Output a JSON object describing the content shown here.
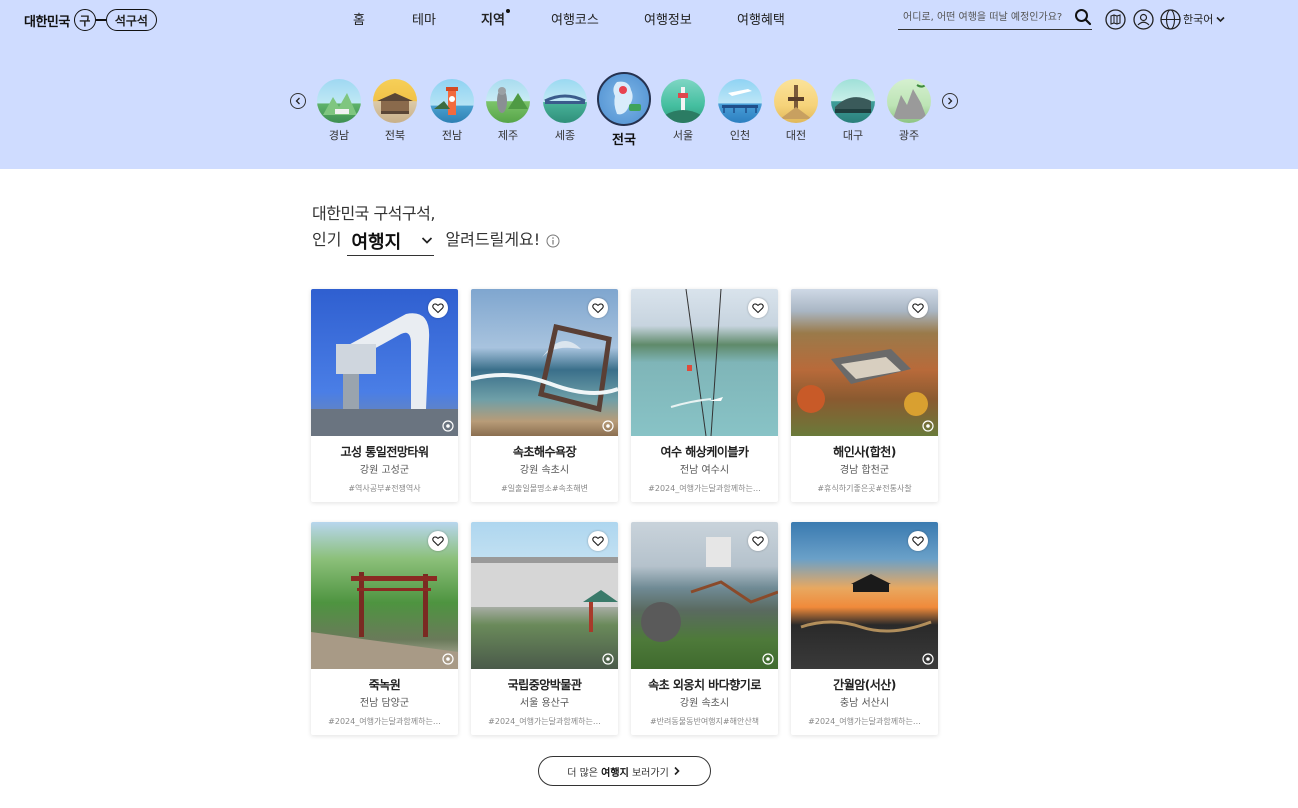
{
  "header": {
    "logo": {
      "text": "대한민국",
      "mark_circle": "구",
      "mark_pill": "석구석"
    },
    "nav": [
      {
        "label": "홈"
      },
      {
        "label": "테마"
      },
      {
        "label": "지역"
      },
      {
        "label": "여행코스"
      },
      {
        "label": "여행정보"
      },
      {
        "label": "여행혜택"
      }
    ],
    "active_nav": "지역",
    "search": {
      "placeholder": "어디로, 어떤 여행을 떠날 예정인가요?"
    },
    "icons": [
      "map-icon",
      "user-icon",
      "globe-icon"
    ],
    "language": "한국어"
  },
  "regions": {
    "items": [
      {
        "label": "경남"
      },
      {
        "label": "전북"
      },
      {
        "label": "전남"
      },
      {
        "label": "제주"
      },
      {
        "label": "세종"
      },
      {
        "label": "전국"
      },
      {
        "label": "서울"
      },
      {
        "label": "인천"
      },
      {
        "label": "대전"
      },
      {
        "label": "대구"
      },
      {
        "label": "광주"
      }
    ],
    "active": "전국"
  },
  "section": {
    "line1": "대한민국 구석구석,",
    "prefix": "인기",
    "select_value": "여행지",
    "suffix": "알려드릴게요!"
  },
  "cards": [
    {
      "title": "고성 통일전망타워",
      "location": "강원 고성군",
      "tags": "#역사공부#전쟁역사"
    },
    {
      "title": "속초해수욕장",
      "location": "강원 속초시",
      "tags": "#일출일몰명소#속초해변"
    },
    {
      "title": "여수 해상케이블카",
      "location": "전남 여수시",
      "tags": "#2024_여행가는달과함께하는…"
    },
    {
      "title": "해인사(합천)",
      "location": "경남 합천군",
      "tags": "#휴식하기좋은곳#전통사찰"
    },
    {
      "title": "죽녹원",
      "location": "전남 담양군",
      "tags": "#2024_여행가는달과함께하는…"
    },
    {
      "title": "국립중앙박물관",
      "location": "서울 용산구",
      "tags": "#2024_여행가는달과함께하는…"
    },
    {
      "title": "속초 외옹치 바다향기로",
      "location": "강원 속초시",
      "tags": "#반려동물동반여행지#해안산책"
    },
    {
      "title": "간월암(서산)",
      "location": "충남 서산시",
      "tags": "#2024_여행가는달과함께하는…"
    }
  ],
  "more_button": {
    "prefix": "더 많은",
    "emphasis": "여행지",
    "suffix": "보러가기"
  },
  "colors": {
    "header_bg": "#cfdcff",
    "text": "#222222",
    "accent": "#111111"
  }
}
